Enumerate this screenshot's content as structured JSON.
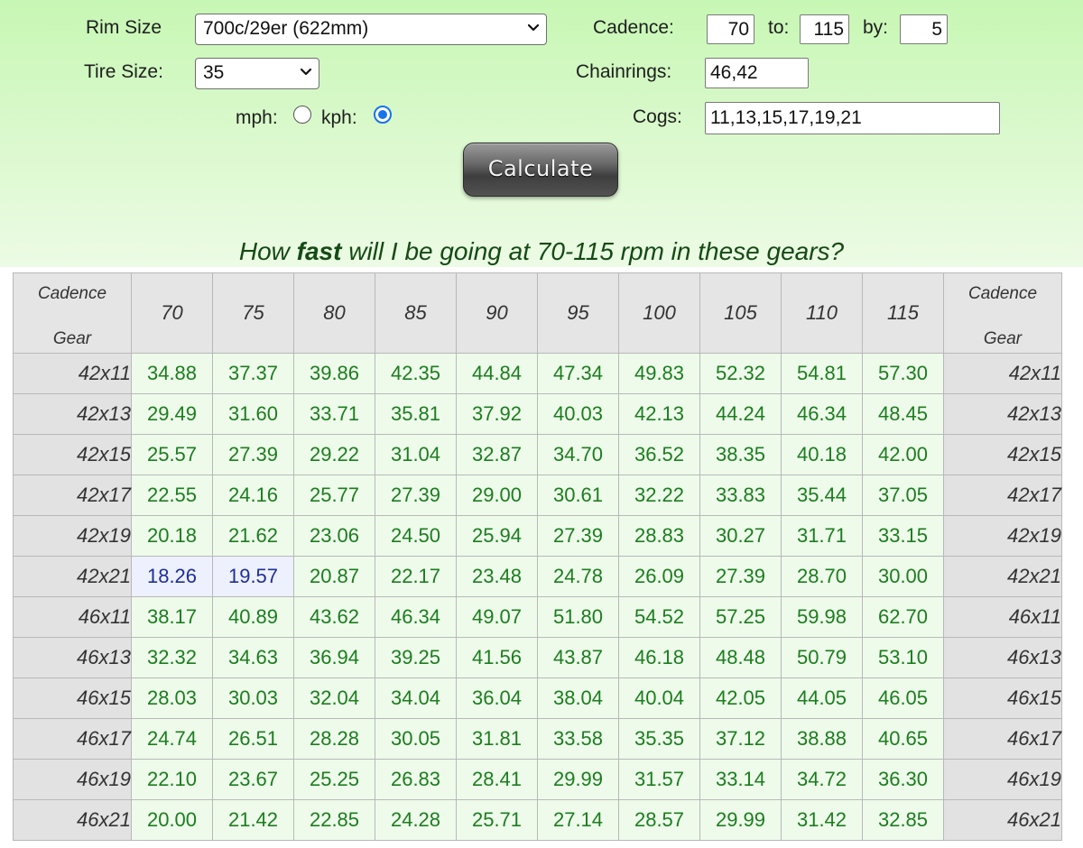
{
  "form": {
    "rim_size_label": "Rim Size",
    "rim_size_value": "700c/29er (622mm)",
    "tire_size_label": "Tire Size:",
    "tire_size_value": "35",
    "mph_label": "mph:",
    "kph_label": "kph:",
    "speed_unit_selected": "kph",
    "cadence_label": "Cadence:",
    "cadence_from": "70",
    "to_label": "to:",
    "cadence_to": "115",
    "by_label": "by:",
    "cadence_step": "5",
    "chainrings_label": "Chainrings:",
    "chainrings_value": "46,42",
    "cogs_label": "Cogs:",
    "cogs_value": "11,13,15,17,19,21",
    "calculate_label": "Calculate"
  },
  "heading": {
    "pre": "How ",
    "bold": "fast",
    "post": " will I be going at 70-115 rpm in these gears?"
  },
  "table": {
    "corner_top": "Cadence",
    "corner_bottom": "Gear",
    "cadences": [
      "70",
      "75",
      "80",
      "85",
      "90",
      "95",
      "100",
      "105",
      "110",
      "115"
    ],
    "highlighted_cells": [
      [
        5,
        0
      ],
      [
        5,
        1
      ]
    ],
    "rows": [
      {
        "gear": "42x11",
        "values": [
          "34.88",
          "37.37",
          "39.86",
          "42.35",
          "44.84",
          "47.34",
          "49.83",
          "52.32",
          "54.81",
          "57.30"
        ]
      },
      {
        "gear": "42x13",
        "values": [
          "29.49",
          "31.60",
          "33.71",
          "35.81",
          "37.92",
          "40.03",
          "42.13",
          "44.24",
          "46.34",
          "48.45"
        ]
      },
      {
        "gear": "42x15",
        "values": [
          "25.57",
          "27.39",
          "29.22",
          "31.04",
          "32.87",
          "34.70",
          "36.52",
          "38.35",
          "40.18",
          "42.00"
        ]
      },
      {
        "gear": "42x17",
        "values": [
          "22.55",
          "24.16",
          "25.77",
          "27.39",
          "29.00",
          "30.61",
          "32.22",
          "33.83",
          "35.44",
          "37.05"
        ]
      },
      {
        "gear": "42x19",
        "values": [
          "20.18",
          "21.62",
          "23.06",
          "24.50",
          "25.94",
          "27.39",
          "28.83",
          "30.27",
          "31.71",
          "33.15"
        ]
      },
      {
        "gear": "42x21",
        "values": [
          "18.26",
          "19.57",
          "20.87",
          "22.17",
          "23.48",
          "24.78",
          "26.09",
          "27.39",
          "28.70",
          "30.00"
        ]
      },
      {
        "gear": "46x11",
        "values": [
          "38.17",
          "40.89",
          "43.62",
          "46.34",
          "49.07",
          "51.80",
          "54.52",
          "57.25",
          "59.98",
          "62.70"
        ]
      },
      {
        "gear": "46x13",
        "values": [
          "32.32",
          "34.63",
          "36.94",
          "39.25",
          "41.56",
          "43.87",
          "46.18",
          "48.48",
          "50.79",
          "53.10"
        ]
      },
      {
        "gear": "46x15",
        "values": [
          "28.03",
          "30.03",
          "32.04",
          "34.04",
          "36.04",
          "38.04",
          "40.04",
          "42.05",
          "44.05",
          "46.05"
        ]
      },
      {
        "gear": "46x17",
        "values": [
          "24.74",
          "26.51",
          "28.28",
          "30.05",
          "31.81",
          "33.58",
          "35.35",
          "37.12",
          "38.88",
          "40.65"
        ]
      },
      {
        "gear": "46x19",
        "values": [
          "22.10",
          "23.67",
          "25.25",
          "26.83",
          "28.41",
          "29.99",
          "31.57",
          "33.14",
          "34.72",
          "36.30"
        ]
      },
      {
        "gear": "46x21",
        "values": [
          "20.00",
          "21.42",
          "22.85",
          "24.28",
          "25.71",
          "27.14",
          "28.57",
          "29.99",
          "31.42",
          "32.85"
        ]
      }
    ]
  }
}
